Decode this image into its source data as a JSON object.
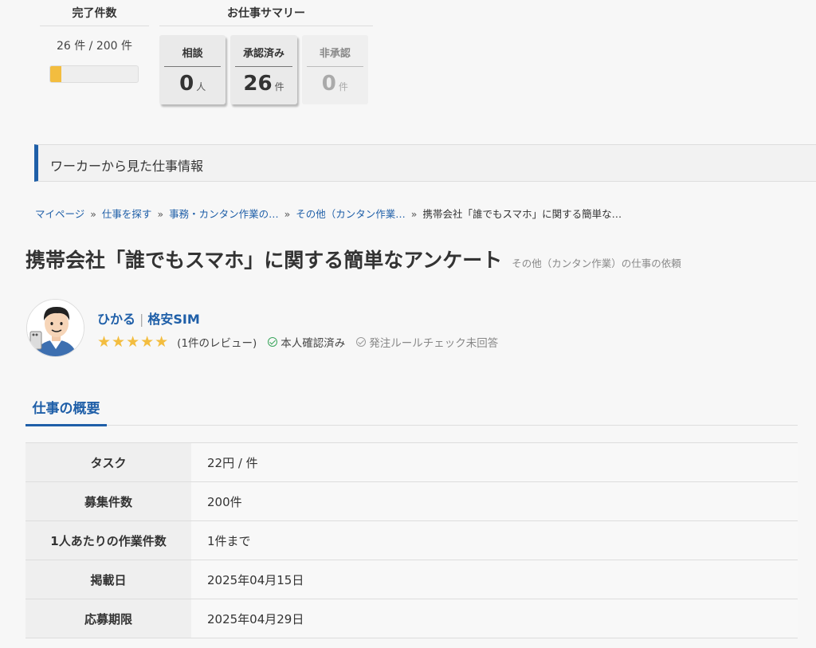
{
  "stats": {
    "done": {
      "heading": "完了件数",
      "count_text": "26 件 / 200 件",
      "progress_fraction": 0.13,
      "progress_color": "#f3bd3f"
    },
    "summary": {
      "heading": "お仕事サマリー",
      "boxes": [
        {
          "label": "相談",
          "value": "0",
          "unit": "人"
        },
        {
          "label": "承認済み",
          "value": "26",
          "unit": "件"
        },
        {
          "label": "非承認",
          "value": "0",
          "unit": "件"
        }
      ]
    }
  },
  "banner": {
    "title": "ワーカーから見た仕事情報",
    "accent": "#1f5fa8"
  },
  "breadcrumb": {
    "items": [
      "マイページ",
      "仕事を探す",
      "事務・カンタン作業の…",
      "その他（カンタン作業…"
    ],
    "current": "携帯会社「誰でもスマホ」に関する簡単な…",
    "separator": "»"
  },
  "job": {
    "title": "携帯会社「誰でもスマホ」に関する簡単なアンケート",
    "category_text": "その他（カンタン作業）の仕事の依頼"
  },
  "client": {
    "name": "ひかる",
    "divider": "|",
    "company": "格安SIM",
    "stars": "★★★★★",
    "review_text": "(1件のレビュー)",
    "verified_text": "本人確認済み",
    "rule_text": "発注ルールチェック未回答",
    "avatar_icon": "avatar-illustration"
  },
  "tabs": {
    "overview": "仕事の概要"
  },
  "details": [
    {
      "label": "タスク",
      "value": "22円 / 件"
    },
    {
      "label": "募集件数",
      "value": "200件"
    },
    {
      "label": "1人あたりの作業件数",
      "value": "1件まで"
    },
    {
      "label": "掲載日",
      "value": "2025年04月15日"
    },
    {
      "label": "応募期限",
      "value": "2025年04月29日"
    }
  ]
}
